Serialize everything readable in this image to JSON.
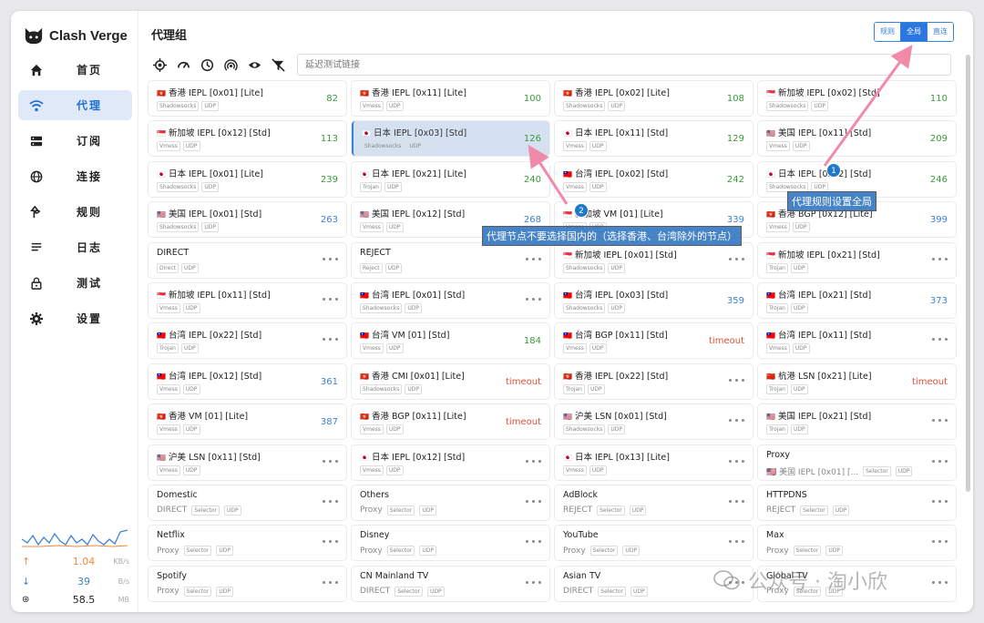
{
  "app": {
    "title": "Clash Verge"
  },
  "sidebar": {
    "items": [
      {
        "label": "首页",
        "icon": "home-icon"
      },
      {
        "label": "代理",
        "icon": "wifi-icon"
      },
      {
        "label": "订阅",
        "icon": "storage-icon"
      },
      {
        "label": "连接",
        "icon": "globe-icon"
      },
      {
        "label": "规则",
        "icon": "fork-icon"
      },
      {
        "label": "日志",
        "icon": "list-icon"
      },
      {
        "label": "测试",
        "icon": "lock-icon"
      },
      {
        "label": "设置",
        "icon": "gear-icon"
      }
    ],
    "active_index": 1,
    "upload": {
      "value": "1.04",
      "unit": "KB/s",
      "color": "#f0883e"
    },
    "download": {
      "value": "39",
      "unit": "B/s",
      "color": "#3b82d6"
    },
    "memory": {
      "value": "58.5",
      "unit": "MB"
    }
  },
  "header": {
    "title": "代理组",
    "modes": [
      "规则",
      "全局",
      "直连"
    ],
    "active_mode": "全局"
  },
  "toolbar": {
    "icons": [
      "locate-icon",
      "speed-icon",
      "clock-icon",
      "signal-icon",
      "eye-icon",
      "filter-off-icon"
    ],
    "search_placeholder": "延迟测试链接"
  },
  "proxies": [
    {
      "flag": "🇭🇰",
      "name": "香港 IEPL [0x01] [Lite]",
      "type": "Shadowsocks",
      "udp": "UDP",
      "latency": "82",
      "lc": "g"
    },
    {
      "flag": "🇭🇰",
      "name": "香港 IEPL [0x11] [Lite]",
      "type": "Vmess",
      "udp": "UDP",
      "latency": "100",
      "lc": "g"
    },
    {
      "flag": "🇭🇰",
      "name": "香港 IEPL [0x02] [Lite]",
      "type": "Shadowsocks",
      "udp": "UDP",
      "latency": "108",
      "lc": "g"
    },
    {
      "flag": "🇸🇬",
      "name": "新加坡 IEPL [0x02] [Std]",
      "type": "Shadowsocks",
      "udp": "UDP",
      "latency": "110",
      "lc": "g"
    },
    {
      "flag": "🇸🇬",
      "name": "新加坡 IEPL [0x12] [Std]",
      "type": "Vmess",
      "udp": "UDP",
      "latency": "113",
      "lc": "g"
    },
    {
      "flag": "🇯🇵",
      "name": "日本 IEPL [0x03] [Std]",
      "type": "Shadowsocks",
      "udp": "UDP",
      "latency": "126",
      "lc": "g",
      "selected": true
    },
    {
      "flag": "🇯🇵",
      "name": "日本 IEPL [0x11] [Std]",
      "type": "Vmess",
      "udp": "UDP",
      "latency": "129",
      "lc": "g"
    },
    {
      "flag": "🇺🇸",
      "name": "美国 IEPL [0x11] [Std]",
      "type": "Vmess",
      "udp": "UDP",
      "latency": "209",
      "lc": "g"
    },
    {
      "flag": "🇯🇵",
      "name": "日本 IEPL [0x01] [Lite]",
      "type": "Shadowsocks",
      "udp": "UDP",
      "latency": "239",
      "lc": "g"
    },
    {
      "flag": "🇯🇵",
      "name": "日本 IEPL [0x21] [Lite]",
      "type": "Trojan",
      "udp": "UDP",
      "latency": "240",
      "lc": "g"
    },
    {
      "flag": "🇹🇼",
      "name": "台湾 IEPL [0x02] [Std]",
      "type": "Vmess",
      "udp": "UDP",
      "latency": "242",
      "lc": "g"
    },
    {
      "flag": "🇯🇵",
      "name": "日本 IEPL [0x02] [Std]",
      "type": "Shadowsocks",
      "udp": "UDP",
      "latency": "246",
      "lc": "g"
    },
    {
      "flag": "🇺🇸",
      "name": "美国 IEPL [0x01] [Std]",
      "type": "Shadowsocks",
      "udp": "UDP",
      "latency": "263",
      "lc": "b"
    },
    {
      "flag": "🇺🇸",
      "name": "美国 IEPL [0x12] [Std]",
      "type": "Vmess",
      "udp": "UDP",
      "latency": "268",
      "lc": "b"
    },
    {
      "flag": "🇸🇬",
      "name": "新加坡 VM [01] [Lite]",
      "type": "Vmess",
      "udp": "UDP",
      "latency": "339",
      "lc": "b"
    },
    {
      "flag": "🇭🇰",
      "name": "香港 BGP [0x12] [Lite]",
      "type": "Vmess",
      "udp": "UDP",
      "latency": "399",
      "lc": "b"
    },
    {
      "flag": "",
      "name": "DIRECT",
      "type": "Direct",
      "udp": "UDP",
      "latency": ""
    },
    {
      "flag": "",
      "name": "REJECT",
      "type": "Reject",
      "udp": "UDP",
      "latency": ""
    },
    {
      "flag": "🇸🇬",
      "name": "新加坡 IEPL [0x01] [Std]",
      "type": "Shadowsocks",
      "udp": "UDP",
      "latency": ""
    },
    {
      "flag": "🇸🇬",
      "name": "新加坡 IEPL [0x21] [Std]",
      "type": "Trojan",
      "udp": "UDP",
      "latency": ""
    },
    {
      "flag": "🇸🇬",
      "name": "新加坡 IEPL [0x11] [Std]",
      "type": "Vmess",
      "udp": "UDP",
      "latency": ""
    },
    {
      "flag": "🇹🇼",
      "name": "台湾 IEPL [0x01] [Std]",
      "type": "Shadowsocks",
      "udp": "UDP",
      "latency": ""
    },
    {
      "flag": "🇹🇼",
      "name": "台湾 IEPL [0x03] [Std]",
      "type": "Shadowsocks",
      "udp": "UDP",
      "latency": "359",
      "lc": "b"
    },
    {
      "flag": "🇹🇼",
      "name": "台湾 IEPL [0x21] [Std]",
      "type": "Trojan",
      "udp": "UDP",
      "latency": "373",
      "lc": "b"
    },
    {
      "flag": "🇹🇼",
      "name": "台湾 IEPL [0x22] [Std]",
      "type": "Trojan",
      "udp": "UDP",
      "latency": ""
    },
    {
      "flag": "🇹🇼",
      "name": "台湾 VM [01] [Std]",
      "type": "Vmess",
      "udp": "UDP",
      "latency": "184",
      "lc": "g"
    },
    {
      "flag": "🇹🇼",
      "name": "台湾 BGP [0x11] [Std]",
      "type": "Vmess",
      "udp": "UDP",
      "latency": "timeout",
      "lc": "r"
    },
    {
      "flag": "🇹🇼",
      "name": "台湾 IEPL [0x11] [Std]",
      "type": "Vmess",
      "udp": "UDP",
      "latency": ""
    },
    {
      "flag": "🇹🇼",
      "name": "台湾 IEPL [0x12] [Std]",
      "type": "Vmess",
      "udp": "UDP",
      "latency": "361",
      "lc": "b"
    },
    {
      "flag": "🇭🇰",
      "name": "香港 CMI [0x01] [Lite]",
      "type": "Shadowsocks",
      "udp": "UDP",
      "latency": "timeout",
      "lc": "r"
    },
    {
      "flag": "🇭🇰",
      "name": "香港 IEPL [0x22] [Std]",
      "type": "Trojan",
      "udp": "UDP",
      "latency": ""
    },
    {
      "flag": "🇨🇳",
      "name": "杭港 LSN [0x21] [Lite]",
      "type": "Trojan",
      "udp": "UDP",
      "latency": "timeout",
      "lc": "r"
    },
    {
      "flag": "🇭🇰",
      "name": "香港 VM [01] [Lite]",
      "type": "Vmess",
      "udp": "UDP",
      "latency": "387",
      "lc": "b"
    },
    {
      "flag": "🇭🇰",
      "name": "香港 BGP [0x11] [Lite]",
      "type": "Vmess",
      "udp": "UDP",
      "latency": "timeout",
      "lc": "r"
    },
    {
      "flag": "🇺🇸",
      "name": "沪美 LSN [0x01] [Std]",
      "type": "Shadowsocks",
      "udp": "UDP",
      "latency": ""
    },
    {
      "flag": "🇺🇸",
      "name": "美国 IEPL [0x21] [Std]",
      "type": "Trojan",
      "udp": "UDP",
      "latency": ""
    },
    {
      "flag": "🇺🇸",
      "name": "沪美 LSN [0x11] [Std]",
      "type": "Vmess",
      "udp": "UDP",
      "latency": ""
    },
    {
      "flag": "🇯🇵",
      "name": "日本 IEPL [0x12] [Std]",
      "type": "Vmess",
      "udp": "UDP",
      "latency": ""
    },
    {
      "flag": "🇯🇵",
      "name": "日本 IEPL [0x13] [Lite]",
      "type": "Vmess",
      "udp": "UDP",
      "latency": ""
    },
    {
      "group": true,
      "name": "Proxy",
      "value": "🇺🇸 美国 IEPL [0x01] [...",
      "type": "Selector",
      "udp": "UDP"
    },
    {
      "group": true,
      "name": "Domestic",
      "value": "DIRECT",
      "type": "Selector",
      "udp": "UDP"
    },
    {
      "group": true,
      "name": "Others",
      "value": "Proxy",
      "type": "Selector",
      "udp": "UDP"
    },
    {
      "group": true,
      "name": "AdBlock",
      "value": "REJECT",
      "type": "Selector",
      "udp": "UDP"
    },
    {
      "group": true,
      "name": "HTTPDNS",
      "value": "REJECT",
      "type": "Selector",
      "udp": "UDP"
    },
    {
      "group": true,
      "name": "Netflix",
      "value": "Proxy",
      "type": "Selector",
      "udp": "UDP"
    },
    {
      "group": true,
      "name": "Disney",
      "value": "Proxy",
      "type": "Selector",
      "udp": "UDP"
    },
    {
      "group": true,
      "name": "YouTube",
      "value": "Proxy",
      "type": "Selector",
      "udp": "UDP"
    },
    {
      "group": true,
      "name": "Max",
      "value": "Proxy",
      "type": "Selector",
      "udp": "UDP"
    },
    {
      "group": true,
      "name": "Spotify",
      "value": "Proxy",
      "type": "Selector",
      "udp": "UDP"
    },
    {
      "group": true,
      "name": "CN Mainland TV",
      "value": "DIRECT",
      "type": "Selector",
      "udp": "UDP"
    },
    {
      "group": true,
      "name": "Asian TV",
      "value": "DIRECT",
      "type": "Selector",
      "udp": "UDP"
    },
    {
      "group": true,
      "name": "Global TV",
      "value": "Proxy",
      "type": "Selector",
      "udp": "UDP"
    }
  ],
  "annotations": [
    {
      "num": "1",
      "text": "代理规则设置全局"
    },
    {
      "num": "2",
      "text": "代理节点不要选择国内的（选择香港、台湾除外的节点）"
    }
  ],
  "watermark": "公众号 · 淘小欣"
}
